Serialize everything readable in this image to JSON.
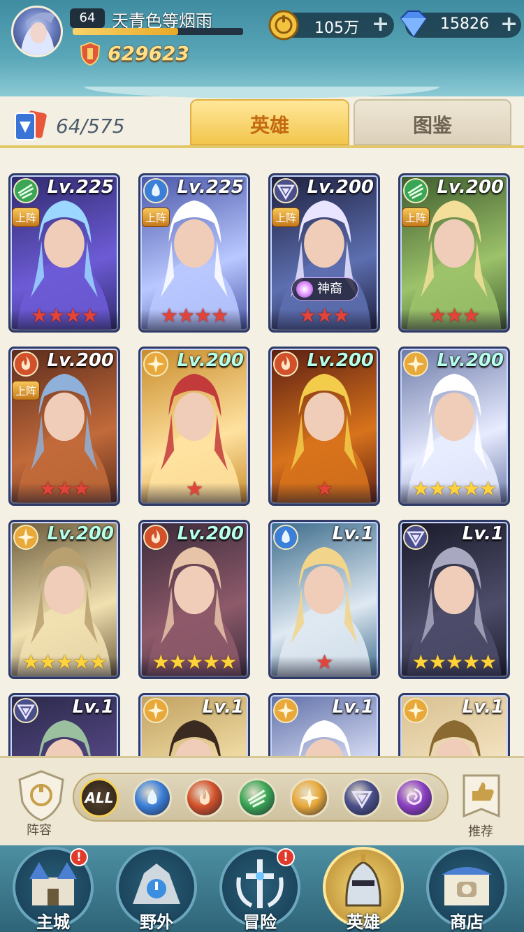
{
  "player": {
    "level": "64",
    "name": "天青色等烟雨",
    "power": "629623",
    "xp_fraction": 0.62
  },
  "resources": {
    "gold": "105万",
    "gems": "15826",
    "plus": "+"
  },
  "collection": {
    "count": "64/575"
  },
  "tabs": {
    "heroes": "英雄",
    "codex": "图鉴",
    "active": "heroes"
  },
  "colors": {
    "fire": "#d2512a",
    "water": "#3b7fd8",
    "wind": "#3aa554",
    "light": "#e8a93a",
    "dark": "#4a4f8a",
    "arcane": "#8a3fc2"
  },
  "heroes": [
    {
      "level": "Lv.225",
      "element": "wind",
      "deployed": true,
      "stars": 4,
      "star_color": "red",
      "lv_style": "white",
      "badge": ""
    },
    {
      "level": "Lv.225",
      "element": "water",
      "deployed": true,
      "stars": 4,
      "star_color": "red",
      "lv_style": "white",
      "badge": ""
    },
    {
      "level": "Lv.200",
      "element": "dark",
      "deployed": true,
      "stars": 3,
      "star_color": "red",
      "lv_style": "white",
      "badge": "神裔"
    },
    {
      "level": "Lv.200",
      "element": "wind",
      "deployed": true,
      "stars": 3,
      "star_color": "red",
      "lv_style": "white",
      "badge": ""
    },
    {
      "level": "Lv.200",
      "element": "fire",
      "deployed": true,
      "stars": 3,
      "star_color": "red",
      "lv_style": "white",
      "badge": ""
    },
    {
      "level": "Lv.200",
      "element": "light",
      "deployed": false,
      "stars": 1,
      "star_color": "red",
      "lv_style": "teal",
      "badge": ""
    },
    {
      "level": "Lv.200",
      "element": "fire",
      "deployed": false,
      "stars": 1,
      "star_color": "red",
      "lv_style": "teal",
      "badge": ""
    },
    {
      "level": "Lv.200",
      "element": "light",
      "deployed": false,
      "stars": 5,
      "star_color": "gold",
      "lv_style": "teal",
      "badge": ""
    },
    {
      "level": "Lv.200",
      "element": "light",
      "deployed": false,
      "stars": 5,
      "star_color": "gold",
      "lv_style": "teal",
      "badge": ""
    },
    {
      "level": "Lv.200",
      "element": "fire",
      "deployed": false,
      "stars": 5,
      "star_color": "gold",
      "lv_style": "teal",
      "badge": ""
    },
    {
      "level": "Lv.1",
      "element": "water",
      "deployed": false,
      "stars": 1,
      "star_color": "red",
      "lv_style": "white",
      "badge": ""
    },
    {
      "level": "Lv.1",
      "element": "dark",
      "deployed": false,
      "stars": 5,
      "star_color": "gold",
      "lv_style": "white",
      "badge": ""
    },
    {
      "level": "Lv.1",
      "element": "dark",
      "deployed": false,
      "stars": 0,
      "star_color": "gold",
      "lv_style": "white",
      "badge": ""
    },
    {
      "level": "Lv.1",
      "element": "light",
      "deployed": false,
      "stars": 0,
      "star_color": "gold",
      "lv_style": "white",
      "badge": ""
    },
    {
      "level": "Lv.1",
      "element": "light",
      "deployed": false,
      "stars": 0,
      "star_color": "gold",
      "lv_style": "white",
      "badge": ""
    },
    {
      "level": "Lv.1",
      "element": "light",
      "deployed": false,
      "stars": 0,
      "star_color": "gold",
      "lv_style": "white",
      "badge": ""
    }
  ],
  "deploy_label": "上阵",
  "filters": {
    "lineup_label": "阵容",
    "all_label": "ALL",
    "recommend_label": "推荐",
    "elements": [
      "water",
      "fire",
      "wind",
      "light",
      "dark",
      "arcane"
    ]
  },
  "nav": [
    {
      "label": "主城",
      "alert": true,
      "active": false
    },
    {
      "label": "野外",
      "alert": false,
      "active": false
    },
    {
      "label": "冒险",
      "alert": true,
      "active": false
    },
    {
      "label": "英雄",
      "alert": false,
      "active": true
    },
    {
      "label": "商店",
      "alert": false,
      "active": false
    }
  ],
  "alert_mark": "!"
}
